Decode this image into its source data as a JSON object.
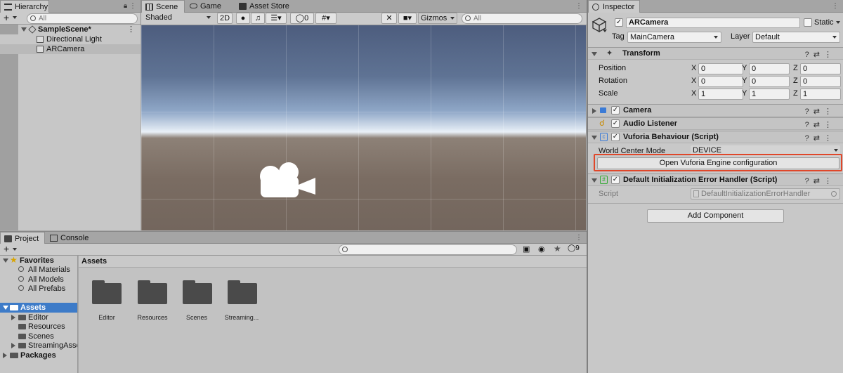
{
  "hierarchy": {
    "tab": "Hierarchy",
    "search_placeholder": "All",
    "add_label": "+",
    "scene": "SampleScene*",
    "items": [
      "Directional Light",
      "ARCamera"
    ]
  },
  "scene_view": {
    "tabs": [
      "Scene",
      "Game",
      "Asset Store"
    ],
    "shading": "Shaded",
    "mode_2d": "2D",
    "hidden_count": "0",
    "gizmos": "Gizmos",
    "search_placeholder": "All"
  },
  "project": {
    "tabs": [
      "Project",
      "Console"
    ],
    "add_label": "+",
    "hidden_count": "9",
    "favorites_label": "Favorites",
    "favorites": [
      "All Materials",
      "All Models",
      "All Prefabs"
    ],
    "assets_label": "Assets",
    "asset_folders": [
      "Editor",
      "Resources",
      "Scenes",
      "StreamingAsse"
    ],
    "packages_label": "Packages",
    "breadcrumb": "Assets",
    "grid_items": [
      "Editor",
      "Resources",
      "Scenes",
      "Streaming..."
    ]
  },
  "inspector": {
    "tab": "Inspector",
    "object_name": "ARCamera",
    "static_label": "Static",
    "tag_label": "Tag",
    "tag_value": "MainCamera",
    "layer_label": "Layer",
    "layer_value": "Default",
    "transform": {
      "title": "Transform",
      "rows": [
        {
          "label": "Position",
          "x": "0",
          "y": "0",
          "z": "0"
        },
        {
          "label": "Rotation",
          "x": "0",
          "y": "0",
          "z": "0"
        },
        {
          "label": "Scale",
          "x": "1",
          "y": "1",
          "z": "1"
        }
      ],
      "axis_x": "X",
      "axis_y": "Y",
      "axis_z": "Z"
    },
    "camera_title": "Camera",
    "audio_title": "Audio Listener",
    "vuforia": {
      "title": "Vuforia Behaviour (Script)",
      "world_center_label": "World Center Mode",
      "world_center_value": "DEVICE",
      "open_config_button": "Open Vuforia Engine configuration"
    },
    "error_handler": {
      "title": "Default Initialization Error Handler (Script)",
      "script_label": "Script",
      "script_value": "DefaultInitializationErrorHandler"
    },
    "add_component": "Add Component"
  },
  "colors": {
    "highlight": "#e0472a",
    "selection": "#3d7bc8"
  }
}
